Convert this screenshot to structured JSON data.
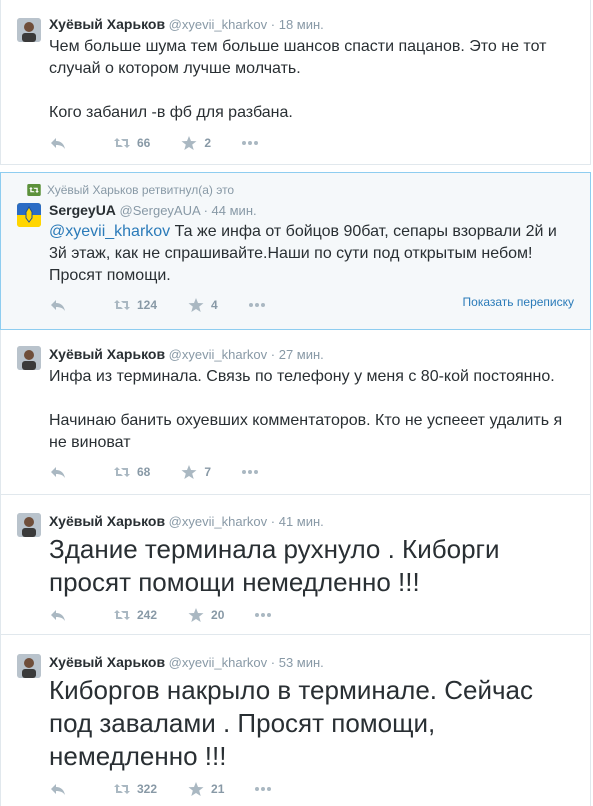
{
  "tweets": [
    {
      "fullname": "Хуёвый Харьков",
      "username": "@xyevii_kharkov",
      "time": "18 мин.",
      "lines": [
        "Чем больше шума тем больше шансов спасти пацанов. Это не тот случай о котором лучше молчать.",
        "",
        "Кого забанил -в фб для разбана."
      ],
      "retweets": "66",
      "favorites": "2"
    },
    {
      "context": "Хуёвый Харьков ретвитнул(а) это",
      "fullname": "SergeyUA",
      "username": "@SergeyAUA",
      "time": "44 мин.",
      "mention": "@xyevii_kharkov",
      "text": " Та же инфа от бойцов 90бат, сепары взорвали 2й и 3й этаж, как не спрашивайте.Наши по сути под открытым небом! Просят помощи.",
      "retweets": "124",
      "favorites": "4",
      "show_conversation": "Показать переписку"
    },
    {
      "fullname": "Хуёвый Харьков",
      "username": "@xyevii_kharkov",
      "time": "27 мин.",
      "line1": "Инфа из терминала. Связь по телефону у меня с 80-кой постоянно.",
      "line2": "Начинаю банить охуевших комментаторов. Кто не успееет удалить я не виноват",
      "retweets": "68",
      "favorites": "7"
    },
    {
      "fullname": "Хуёвый Харьков",
      "username": "@xyevii_kharkov",
      "time": "41 мин.",
      "text": "Здание терминала рухнуло . Киборги просят помощи немедленно !!!",
      "retweets": "242",
      "favorites": "20"
    },
    {
      "fullname": "Хуёвый Харьков",
      "username": "@xyevii_kharkov",
      "time": "53 мин.",
      "text": "Киборгов накрыло в терминале. Сейчас под завалами . Просят помощи, немедленно !!!",
      "retweets": "322",
      "favorites": "21"
    }
  ],
  "colors": {
    "link": "#2b7bb9",
    "muted": "#8899a6",
    "text": "#292f33",
    "highlight_border": "#8ecdf0"
  },
  "icons": [
    "reply-icon",
    "retweet-icon",
    "favorite-icon",
    "more-icon",
    "avatar"
  ]
}
